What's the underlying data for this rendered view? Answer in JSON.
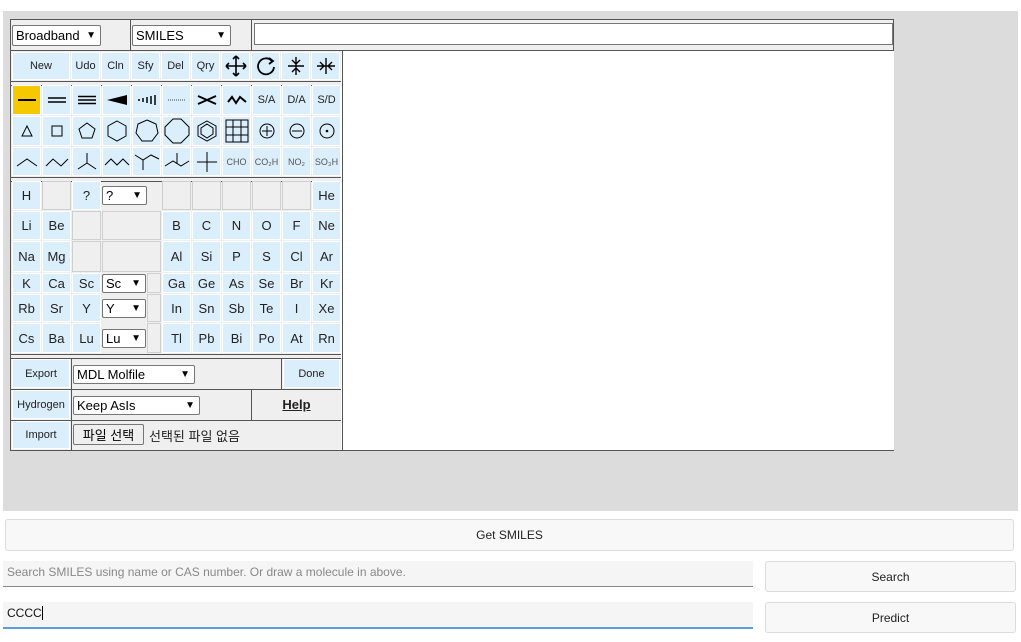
{
  "editor": {
    "mode_select": "Broadband",
    "format_select": "SMILES",
    "smiles_display": ""
  },
  "toolbar": {
    "new": "New",
    "undo": "Udo",
    "clean": "Cln",
    "simplify": "Sfy",
    "delete": "Del",
    "query": "Qry"
  },
  "bond_tools": {
    "sa": "S/A",
    "da": "D/A",
    "sd": "S/D"
  },
  "group_tools": {
    "cho": "CHO",
    "co2h": "CO₂H",
    "no2": "NO₂",
    "so3h": "SO₃H"
  },
  "elements": {
    "row1": [
      "H",
      "?",
      "He"
    ],
    "query_select": "?",
    "row2": [
      "Li",
      "Be",
      "B",
      "C",
      "N",
      "O",
      "F",
      "Ne"
    ],
    "row3": [
      "Na",
      "Mg",
      "Al",
      "Si",
      "P",
      "S",
      "Cl",
      "Ar"
    ],
    "row4": [
      "K",
      "Ca",
      "Sc",
      "Ga",
      "Ge",
      "As",
      "Se",
      "Br",
      "Kr"
    ],
    "row4_select": "Sc",
    "row5": [
      "Rb",
      "Sr",
      "Y",
      "In",
      "Sn",
      "Sb",
      "Te",
      "I",
      "Xe"
    ],
    "row5_select": "Y",
    "row6": [
      "Cs",
      "Ba",
      "Lu",
      "Tl",
      "Pb",
      "Bi",
      "Po",
      "At",
      "Rn"
    ],
    "row6_select": "Lu"
  },
  "bottom": {
    "export": "Export",
    "export_format": "MDL Molfile",
    "done": "Done",
    "hydrogen": "Hydrogen",
    "hydrogen_mode": "Keep AsIs",
    "help": "Help",
    "import": "Import",
    "file_button": "파일 선택",
    "file_status": "선택된 파일 없음"
  },
  "page": {
    "get_smiles": "Get SMILES",
    "search_placeholder": "Search SMILES using name or CAS number. Or draw a molecule in above.",
    "search_button": "Search",
    "smiles_value": "CCCC",
    "predict_button": "Predict"
  },
  "colors": {
    "selected_tool": "#f5c800",
    "tool_bg": "#dbeefb",
    "focus_underline": "#5aa0dc"
  }
}
